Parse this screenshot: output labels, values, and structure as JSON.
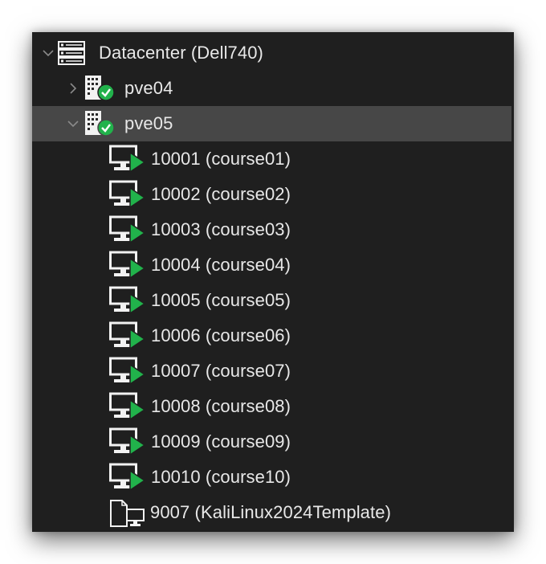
{
  "tree": {
    "datacenter": {
      "label": "Datacenter (Dell740)",
      "icon": "server-rack-icon",
      "expanded": true
    },
    "nodes": [
      {
        "label": "pve04",
        "icon": "node-online-icon",
        "expanded": false,
        "selected": false
      },
      {
        "label": "pve05",
        "icon": "node-online-icon",
        "expanded": true,
        "selected": true
      }
    ],
    "vms": [
      {
        "label": "10001 (course01)",
        "icon": "vm-running-icon"
      },
      {
        "label": "10002 (course02)",
        "icon": "vm-running-icon"
      },
      {
        "label": "10003 (course03)",
        "icon": "vm-running-icon"
      },
      {
        "label": "10004 (course04)",
        "icon": "vm-running-icon"
      },
      {
        "label": "10005 (course05)",
        "icon": "vm-running-icon"
      },
      {
        "label": "10006 (course06)",
        "icon": "vm-running-icon"
      },
      {
        "label": "10007 (course07)",
        "icon": "vm-running-icon"
      },
      {
        "label": "10008 (course08)",
        "icon": "vm-running-icon"
      },
      {
        "label": "10009 (course09)",
        "icon": "vm-running-icon"
      },
      {
        "label": "10010 (course10)",
        "icon": "vm-running-icon"
      }
    ],
    "template": {
      "label": "9007 (KaliLinux2024Template)",
      "icon": "template-icon"
    }
  },
  "colors": {
    "background": "#1f1f1f",
    "selected_row": "#474747",
    "text": "#e8e8e8",
    "status_green": "#21b24b",
    "icon_light": "#f2f2f2"
  }
}
